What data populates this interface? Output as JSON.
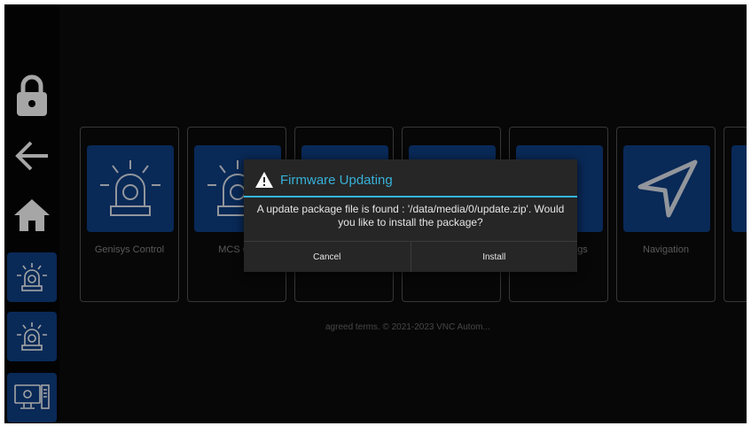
{
  "sidebar": {
    "items": [
      {
        "icon": "lock-icon"
      },
      {
        "icon": "arrow-left-icon"
      },
      {
        "icon": "home-icon"
      },
      {
        "icon": "beacon-icon"
      },
      {
        "icon": "beacon-icon"
      },
      {
        "icon": "computer-icon"
      }
    ]
  },
  "tiles": [
    {
      "label": "Genisys Control",
      "icon": "beacon-icon"
    },
    {
      "label": "MCS Co",
      "icon": "beacon-icon"
    },
    {
      "label": "",
      "icon": ""
    },
    {
      "label": "",
      "icon": ""
    },
    {
      "label": "gs",
      "icon": "settings-icon"
    },
    {
      "label": "Navigation",
      "icon": "navigation-icon"
    }
  ],
  "footer": {
    "text": "agreed terms. © 2021-2023 VNC Autom..."
  },
  "dialog": {
    "title": "Firmware Updating",
    "message": "A update package file is found : '/data/media/0/update.zip'. Would you like to install the package?",
    "cancel_label": "Cancel",
    "install_label": "Install",
    "accent_color": "#33b5e5"
  },
  "colors": {
    "tile_blue": "#0e3f86",
    "background": "#0b0b0b"
  }
}
